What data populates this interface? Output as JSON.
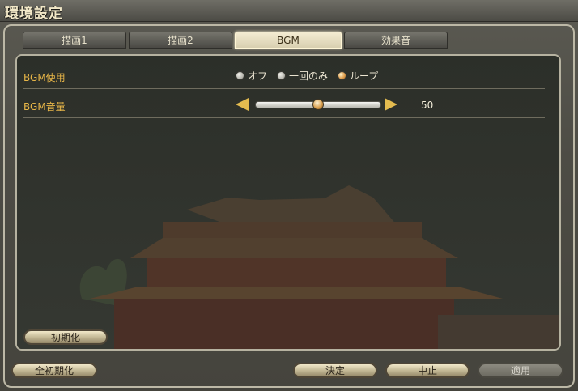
{
  "window": {
    "title": "環境設定"
  },
  "tabs": [
    {
      "label": "描画1",
      "active": false
    },
    {
      "label": "描画2",
      "active": false
    },
    {
      "label": "BGM",
      "active": true
    },
    {
      "label": "効果音",
      "active": false
    }
  ],
  "settings": {
    "bgm_use": {
      "label": "BGM使用",
      "options": [
        "オフ",
        "一回のみ",
        "ループ"
      ],
      "selected": "ループ"
    },
    "bgm_volume": {
      "label": "BGM音量",
      "value": "50",
      "fraction": 0.5
    }
  },
  "buttons": {
    "reset": "初期化",
    "reset_all": "全初期化",
    "ok": "決定",
    "cancel": "中止",
    "apply": "適用"
  },
  "colors": {
    "accent_label": "#e8b648",
    "tab_active": "#f4ecd2"
  }
}
